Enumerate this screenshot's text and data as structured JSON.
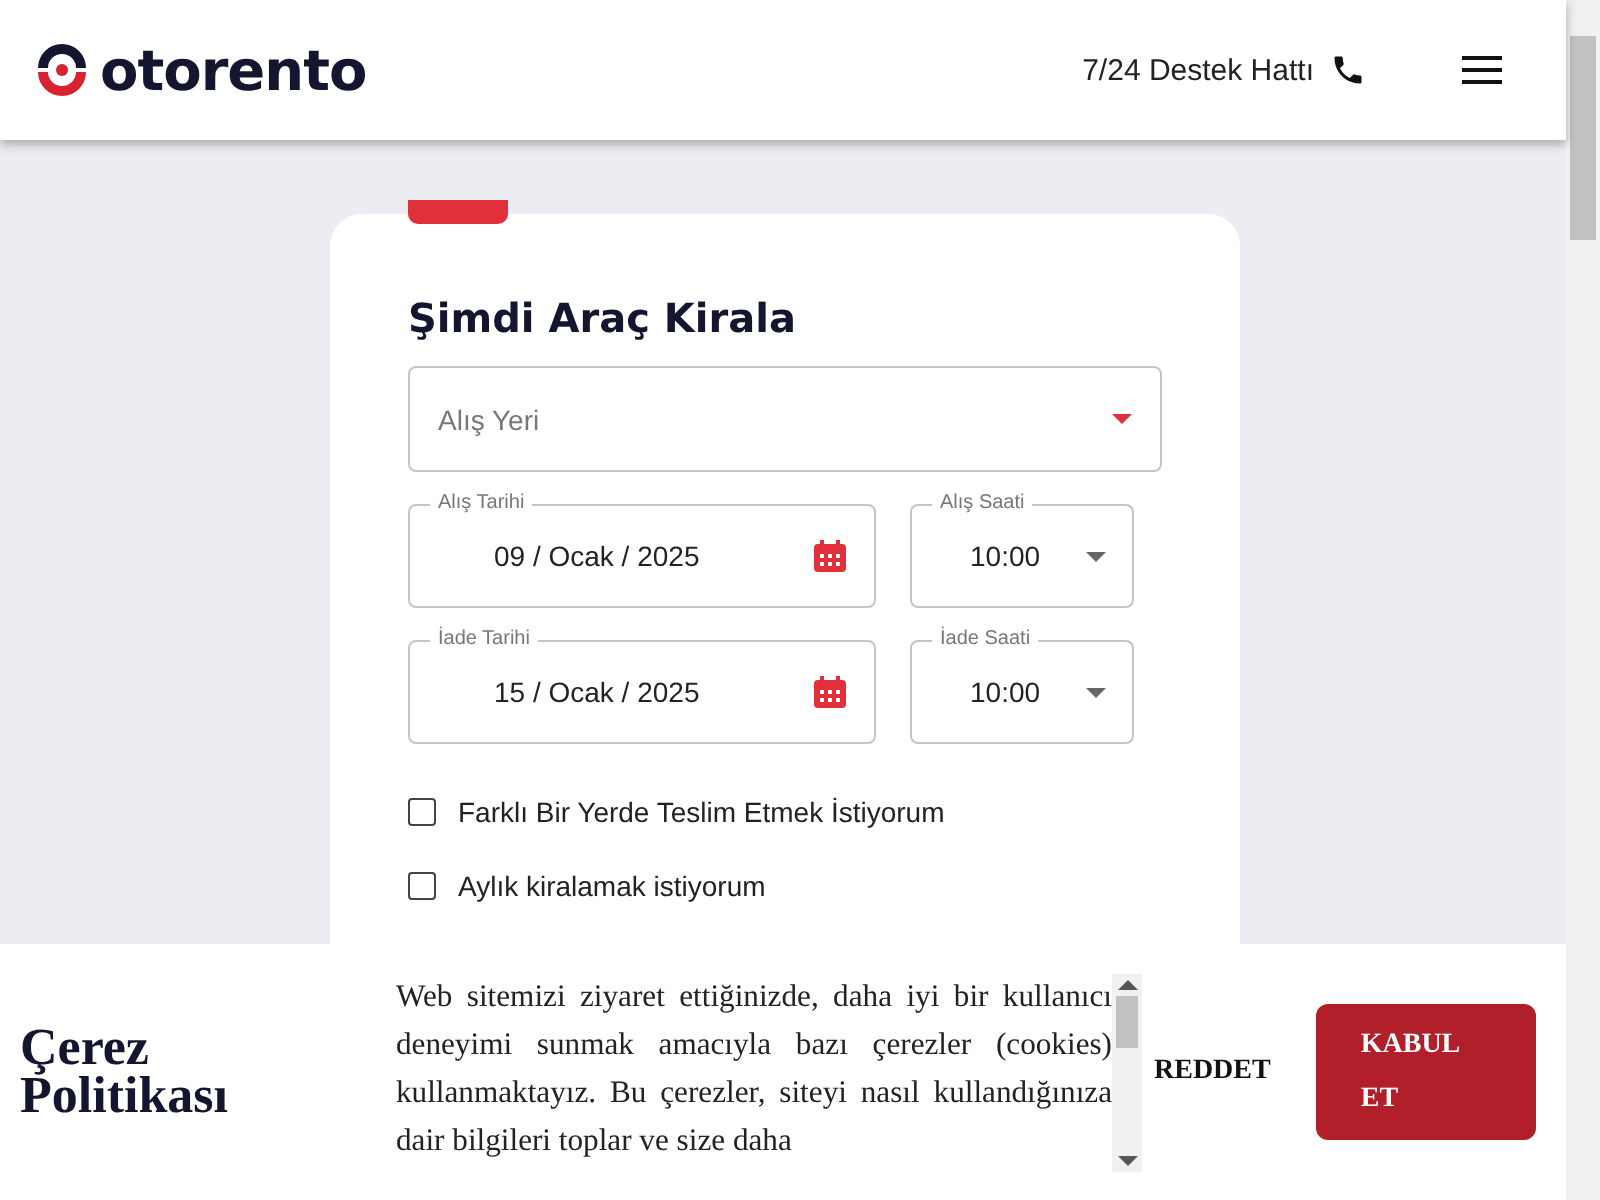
{
  "header": {
    "logo": "otorento",
    "support_label": "7/24 Destek Hattı"
  },
  "rental_form": {
    "title": "Şimdi Araç Kirala",
    "pickup_location": {
      "placeholder": "Alış Yeri"
    },
    "date_rows": [
      {
        "date_label": "Alış Tarihi",
        "date": "09 / Ocak / 2025",
        "time_label": "Alış Saati",
        "time": "10:00"
      },
      {
        "date_label": "İade Tarihi",
        "date": "15 / Ocak / 2025",
        "time_label": "İade Saati",
        "time": "10:00"
      }
    ],
    "options": [
      {
        "label": "Farklı Bir Yerde Teslim Etmek İstiyorum",
        "checked": false
      },
      {
        "label": "Aylık kiralamak istiyorum",
        "checked": false
      }
    ]
  },
  "cookie_banner": {
    "title": "Çerez Politikası",
    "text": "Web sitemizi ziyaret ettiğinizde, daha iyi bir kullanıcı deneyimi sunmak amacıyla bazı çerezler (cookies) kullanmaktayız. Bu çerezler, siteyi nasıl kullandığınıza dair bilgileri toplar ve size daha",
    "buttons": [
      {
        "label": "REDDET",
        "kind": "text"
      },
      {
        "label": "KABUL ET",
        "kind": "primary"
      }
    ]
  }
}
